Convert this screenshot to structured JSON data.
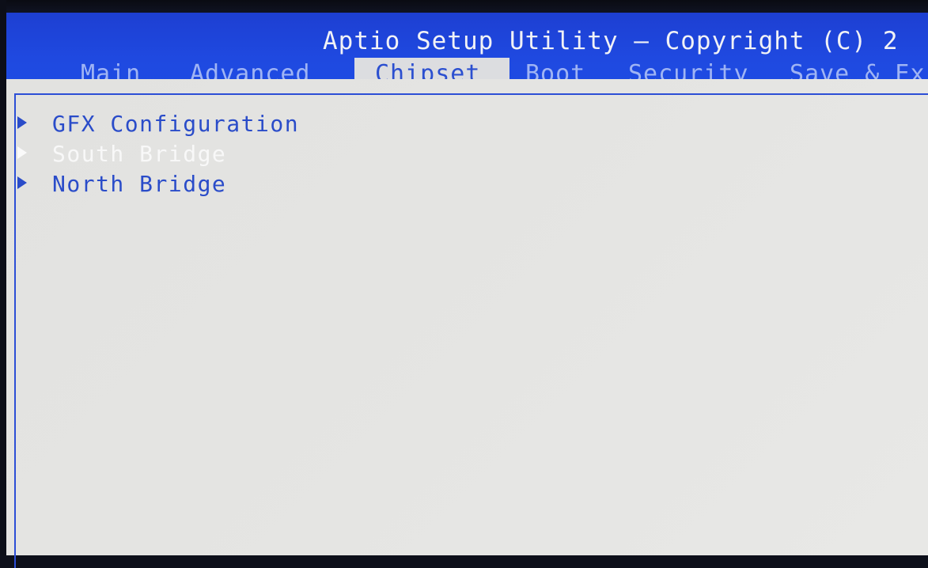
{
  "header": {
    "title": "Aptio Setup Utility – Copyright (C) 2"
  },
  "tabs": [
    {
      "label": "Main",
      "active": false
    },
    {
      "label": "Advanced",
      "active": false
    },
    {
      "label": "Chipset",
      "active": true
    },
    {
      "label": "Boot",
      "active": false
    },
    {
      "label": "Security",
      "active": false
    },
    {
      "label": "Save & Ex",
      "active": false
    }
  ],
  "menu": {
    "items": [
      {
        "label": "GFX Configuration",
        "icon": "submenu-arrow-icon"
      },
      {
        "label": "South Bridge",
        "icon": "submenu-arrow-icon",
        "selected": true
      },
      {
        "label": "North Bridge",
        "icon": "submenu-arrow-icon"
      }
    ]
  },
  "colors": {
    "header_blue": "#1f49e0",
    "panel_bg": "#e4e4e2",
    "item_text": "#2a4cc9",
    "selected_text": "#f8f8f8"
  }
}
